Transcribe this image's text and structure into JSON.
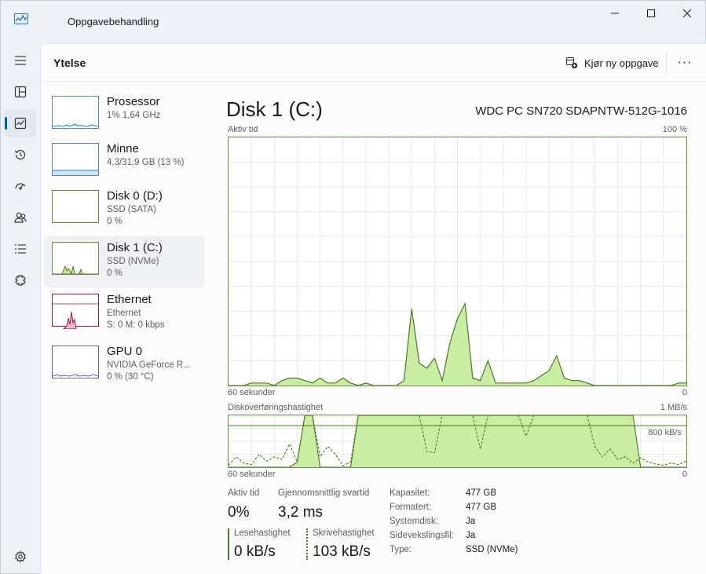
{
  "window": {
    "title": "Oppgavebehandling"
  },
  "colors": {
    "accent": "#005fb8",
    "disk_line": "#4d7a1f",
    "disk_fill": "#c9eda2",
    "ethernet": "#a0154f",
    "cpu": "#1a7fc7"
  },
  "rail": {
    "items": [
      {
        "name": "menu-icon"
      },
      {
        "name": "processes-icon"
      },
      {
        "name": "performance-icon"
      },
      {
        "name": "app-history-icon"
      },
      {
        "name": "startup-apps-icon"
      },
      {
        "name": "users-icon"
      },
      {
        "name": "details-icon"
      },
      {
        "name": "services-icon"
      }
    ],
    "settings": "settings-icon"
  },
  "commandbar": {
    "page_title": "Ytelse",
    "run_task_label": "Kjør ny oppgave",
    "more_label": "···"
  },
  "devices": [
    {
      "name": "Prosessor",
      "sub1": "1% 1,64 GHz",
      "sub2": ""
    },
    {
      "name": "Minne",
      "sub1": "4,3/31,9 GB (13 %)",
      "sub2": ""
    },
    {
      "name": "Disk 0 (D:)",
      "sub1": "SSD (SATA)",
      "sub2": "0 %"
    },
    {
      "name": "Disk 1 (C:)",
      "sub1": "SSD (NVMe)",
      "sub2": "0 %"
    },
    {
      "name": "Ethernet",
      "sub1": "Ethernet",
      "sub2": "S: 0 M: 0 kbps"
    },
    {
      "name": "GPU 0",
      "sub1": "NVIDIA GeForce R...",
      "sub2": "0 % (30 °C)"
    }
  ],
  "detail": {
    "title": "Disk 1 (C:)",
    "model": "WDC PC SN720 SDAPNTW-512G-1016",
    "active_chart": {
      "label": "Aktiv tid",
      "max_label": "100 %",
      "time_label": "60 sekunder",
      "min_label": "0",
      "values": [
        0,
        0,
        0,
        1,
        1,
        1,
        0,
        2,
        3,
        3,
        2,
        1,
        3,
        1,
        1,
        3,
        1,
        0,
        1,
        0,
        0,
        0,
        0,
        2,
        31,
        9,
        7,
        11,
        2,
        17,
        27,
        33,
        3,
        2,
        10,
        1,
        1,
        1,
        1,
        1,
        2,
        4,
        6,
        12,
        3,
        2,
        2,
        1,
        0,
        0,
        0,
        0,
        0,
        0,
        0,
        0,
        0,
        0,
        0,
        1,
        1
      ]
    },
    "transfer_chart": {
      "label": "Diskoverføringshastighet",
      "max_label": "1 MB/s",
      "ref_label": "800 kB/s",
      "time_label": "60 sekunder",
      "min_label": "0",
      "read_values": [
        0,
        0,
        0,
        0,
        0,
        0,
        0,
        0,
        0,
        10,
        100,
        100,
        0,
        0,
        0,
        0,
        0,
        100,
        100,
        100,
        100,
        100,
        100,
        100,
        100,
        100,
        100,
        100,
        100,
        100,
        100,
        100,
        100,
        100,
        100,
        100,
        100,
        100,
        100,
        100,
        100,
        100,
        100,
        100,
        100,
        100,
        100,
        100,
        100,
        100,
        100,
        100,
        100,
        100,
        0,
        0,
        0,
        0,
        0,
        0,
        0
      ],
      "write_values": [
        4,
        20,
        8,
        5,
        25,
        12,
        20,
        15,
        45,
        10,
        100,
        100,
        20,
        40,
        25,
        3,
        10,
        100,
        100,
        100,
        100,
        100,
        100,
        100,
        100,
        100,
        30,
        28,
        100,
        100,
        100,
        100,
        100,
        35,
        100,
        100,
        100,
        100,
        100,
        60,
        100,
        100,
        100,
        100,
        100,
        100,
        100,
        100,
        40,
        20,
        35,
        15,
        20,
        8,
        18,
        10,
        6,
        4,
        8,
        5,
        12
      ]
    },
    "stats": {
      "active_time_label": "Aktiv tid",
      "active_time_value": "0%",
      "avg_response_label": "Gjennomsnittlig svartid",
      "avg_response_value": "3,2 ms",
      "read_speed_label": "Lesehastighet",
      "read_speed_value": "0 kB/s",
      "write_speed_label": "Skrivehastighet",
      "write_speed_value": "103 kB/s"
    },
    "properties": [
      {
        "key": "Kapasitet:",
        "value": "477 GB"
      },
      {
        "key": "Formatert:",
        "value": "477 GB"
      },
      {
        "key": "Systemdisk:",
        "value": "Ja"
      },
      {
        "key": "Sidevekslingsfil:",
        "value": "Ja"
      },
      {
        "key": "Type:",
        "value": "SSD (NVMe)"
      }
    ]
  }
}
